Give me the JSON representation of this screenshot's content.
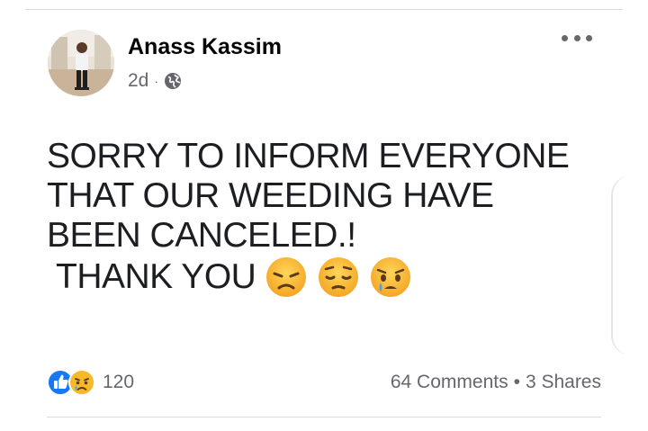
{
  "post": {
    "author": "Anass Kassim",
    "time": "2d",
    "separator": "·",
    "audience_icon": "globe-icon",
    "text_lines": [
      "SORRY TO INFORM EVERYONE",
      "THAT OUR WEEDING HAVE",
      "BEEN CANCELED.!",
      "THANK YOU"
    ],
    "emojis": [
      "disappointed-face",
      "pensive-face",
      "crying-face"
    ]
  },
  "footer": {
    "reaction_icons": [
      "like-icon",
      "sad-icon"
    ],
    "reaction_count": "120",
    "comments": "64 Comments",
    "dot": "•",
    "shares": "3 Shares"
  },
  "colors": {
    "like_blue": "#1877f2",
    "emoji_yellow": "#f7b928",
    "secondary_text": "#65676b"
  }
}
